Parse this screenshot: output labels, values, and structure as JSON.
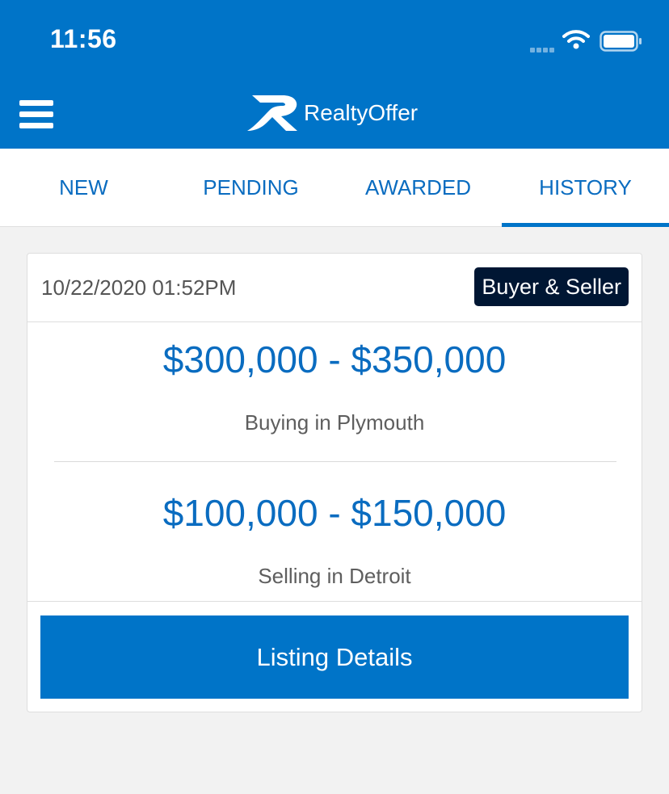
{
  "status_bar": {
    "time": "11:56"
  },
  "header": {
    "app_name": "RealtyOffer"
  },
  "tabs": [
    {
      "label": "NEW"
    },
    {
      "label": "PENDING"
    },
    {
      "label": "AWARDED"
    },
    {
      "label": "HISTORY",
      "active": true
    }
  ],
  "listing": {
    "datetime": "10/22/2020 01:52PM",
    "badge": "Buyer & Seller",
    "buying_range": "$300,000 - $350,000",
    "buying_location": "Buying in Plymouth",
    "selling_range": "$100,000 - $150,000",
    "selling_location": "Selling in Detroit",
    "details_button": "Listing Details"
  },
  "colors": {
    "brand_blue": "#0074c8",
    "badge_navy": "#001633",
    "price_blue": "#0a6cc0"
  }
}
